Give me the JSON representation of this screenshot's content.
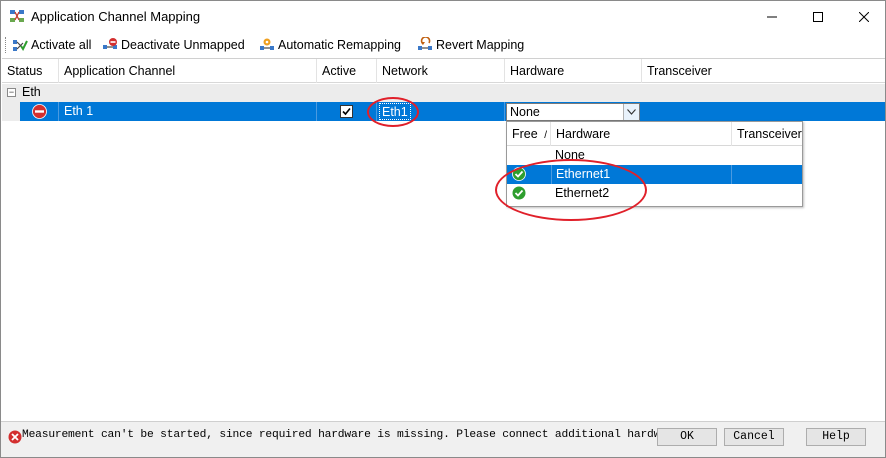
{
  "window": {
    "title": "Application Channel Mapping"
  },
  "toolbar": {
    "activate_all": "Activate all",
    "deactivate_unmapped": "Deactivate Unmapped",
    "automatic_remapping": "Automatic Remapping",
    "revert_mapping": "Revert Mapping"
  },
  "grid": {
    "columns": [
      "Status",
      "Application Channel",
      "Active",
      "Network",
      "Hardware",
      "Transceiver"
    ],
    "group": {
      "label": "Eth",
      "expander": "⊟"
    },
    "rows": [
      {
        "status": "error",
        "channel": "Eth 1",
        "active": true,
        "network": "Eth1",
        "hardware": "None",
        "transceiver": ""
      }
    ]
  },
  "dropdown": {
    "columns": [
      "Free",
      "Hardware",
      "Transceiver"
    ],
    "sort_indicator": "/",
    "items": [
      {
        "free": "",
        "hardware": "None",
        "transceiver": ""
      },
      {
        "free": "ok",
        "hardware": "Ethernet1",
        "transceiver": "",
        "selected": true
      },
      {
        "free": "ok",
        "hardware": "Ethernet2",
        "transceiver": ""
      }
    ]
  },
  "footer": {
    "message": "Measurement can't be started, since required hardware is missing. Please connect additional hardware.",
    "ok": "OK",
    "cancel": "Cancel",
    "help": "Help"
  },
  "colors": {
    "selection": "#0078d7",
    "annotation": "#e0202a",
    "error": "#d32f2f",
    "ok": "#2e9e2e"
  }
}
